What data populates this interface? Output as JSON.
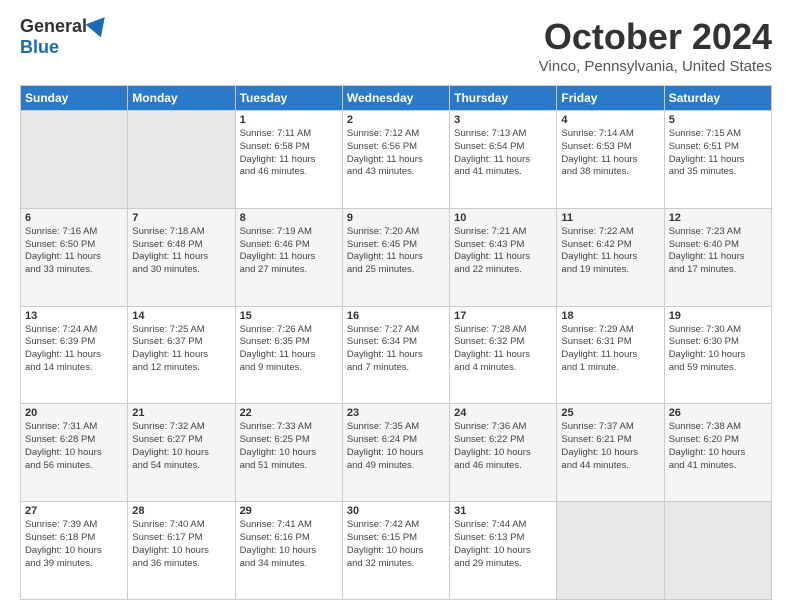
{
  "header": {
    "logo_general": "General",
    "logo_blue": "Blue",
    "title": "October 2024",
    "location": "Vinco, Pennsylvania, United States"
  },
  "calendar": {
    "days_of_week": [
      "Sunday",
      "Monday",
      "Tuesday",
      "Wednesday",
      "Thursday",
      "Friday",
      "Saturday"
    ],
    "weeks": [
      [
        {
          "day": "",
          "info": ""
        },
        {
          "day": "",
          "info": ""
        },
        {
          "day": "1",
          "info": "Sunrise: 7:11 AM\nSunset: 6:58 PM\nDaylight: 11 hours\nand 46 minutes."
        },
        {
          "day": "2",
          "info": "Sunrise: 7:12 AM\nSunset: 6:56 PM\nDaylight: 11 hours\nand 43 minutes."
        },
        {
          "day": "3",
          "info": "Sunrise: 7:13 AM\nSunset: 6:54 PM\nDaylight: 11 hours\nand 41 minutes."
        },
        {
          "day": "4",
          "info": "Sunrise: 7:14 AM\nSunset: 6:53 PM\nDaylight: 11 hours\nand 38 minutes."
        },
        {
          "day": "5",
          "info": "Sunrise: 7:15 AM\nSunset: 6:51 PM\nDaylight: 11 hours\nand 35 minutes."
        }
      ],
      [
        {
          "day": "6",
          "info": "Sunrise: 7:16 AM\nSunset: 6:50 PM\nDaylight: 11 hours\nand 33 minutes."
        },
        {
          "day": "7",
          "info": "Sunrise: 7:18 AM\nSunset: 6:48 PM\nDaylight: 11 hours\nand 30 minutes."
        },
        {
          "day": "8",
          "info": "Sunrise: 7:19 AM\nSunset: 6:46 PM\nDaylight: 11 hours\nand 27 minutes."
        },
        {
          "day": "9",
          "info": "Sunrise: 7:20 AM\nSunset: 6:45 PM\nDaylight: 11 hours\nand 25 minutes."
        },
        {
          "day": "10",
          "info": "Sunrise: 7:21 AM\nSunset: 6:43 PM\nDaylight: 11 hours\nand 22 minutes."
        },
        {
          "day": "11",
          "info": "Sunrise: 7:22 AM\nSunset: 6:42 PM\nDaylight: 11 hours\nand 19 minutes."
        },
        {
          "day": "12",
          "info": "Sunrise: 7:23 AM\nSunset: 6:40 PM\nDaylight: 11 hours\nand 17 minutes."
        }
      ],
      [
        {
          "day": "13",
          "info": "Sunrise: 7:24 AM\nSunset: 6:39 PM\nDaylight: 11 hours\nand 14 minutes."
        },
        {
          "day": "14",
          "info": "Sunrise: 7:25 AM\nSunset: 6:37 PM\nDaylight: 11 hours\nand 12 minutes."
        },
        {
          "day": "15",
          "info": "Sunrise: 7:26 AM\nSunset: 6:35 PM\nDaylight: 11 hours\nand 9 minutes."
        },
        {
          "day": "16",
          "info": "Sunrise: 7:27 AM\nSunset: 6:34 PM\nDaylight: 11 hours\nand 7 minutes."
        },
        {
          "day": "17",
          "info": "Sunrise: 7:28 AM\nSunset: 6:32 PM\nDaylight: 11 hours\nand 4 minutes."
        },
        {
          "day": "18",
          "info": "Sunrise: 7:29 AM\nSunset: 6:31 PM\nDaylight: 11 hours\nand 1 minute."
        },
        {
          "day": "19",
          "info": "Sunrise: 7:30 AM\nSunset: 6:30 PM\nDaylight: 10 hours\nand 59 minutes."
        }
      ],
      [
        {
          "day": "20",
          "info": "Sunrise: 7:31 AM\nSunset: 6:28 PM\nDaylight: 10 hours\nand 56 minutes."
        },
        {
          "day": "21",
          "info": "Sunrise: 7:32 AM\nSunset: 6:27 PM\nDaylight: 10 hours\nand 54 minutes."
        },
        {
          "day": "22",
          "info": "Sunrise: 7:33 AM\nSunset: 6:25 PM\nDaylight: 10 hours\nand 51 minutes."
        },
        {
          "day": "23",
          "info": "Sunrise: 7:35 AM\nSunset: 6:24 PM\nDaylight: 10 hours\nand 49 minutes."
        },
        {
          "day": "24",
          "info": "Sunrise: 7:36 AM\nSunset: 6:22 PM\nDaylight: 10 hours\nand 46 minutes."
        },
        {
          "day": "25",
          "info": "Sunrise: 7:37 AM\nSunset: 6:21 PM\nDaylight: 10 hours\nand 44 minutes."
        },
        {
          "day": "26",
          "info": "Sunrise: 7:38 AM\nSunset: 6:20 PM\nDaylight: 10 hours\nand 41 minutes."
        }
      ],
      [
        {
          "day": "27",
          "info": "Sunrise: 7:39 AM\nSunset: 6:18 PM\nDaylight: 10 hours\nand 39 minutes."
        },
        {
          "day": "28",
          "info": "Sunrise: 7:40 AM\nSunset: 6:17 PM\nDaylight: 10 hours\nand 36 minutes."
        },
        {
          "day": "29",
          "info": "Sunrise: 7:41 AM\nSunset: 6:16 PM\nDaylight: 10 hours\nand 34 minutes."
        },
        {
          "day": "30",
          "info": "Sunrise: 7:42 AM\nSunset: 6:15 PM\nDaylight: 10 hours\nand 32 minutes."
        },
        {
          "day": "31",
          "info": "Sunrise: 7:44 AM\nSunset: 6:13 PM\nDaylight: 10 hours\nand 29 minutes."
        },
        {
          "day": "",
          "info": ""
        },
        {
          "day": "",
          "info": ""
        }
      ]
    ]
  }
}
